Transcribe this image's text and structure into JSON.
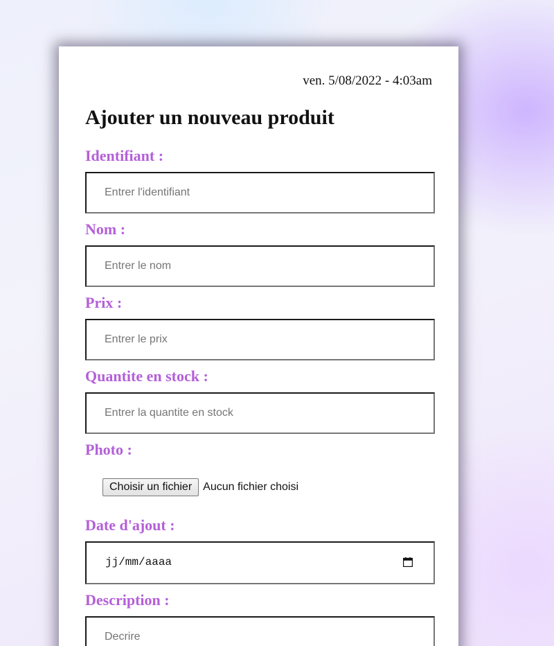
{
  "header": {
    "datetime": "ven. 5/08/2022 - 4:03am",
    "title": "Ajouter un nouveau produit"
  },
  "form": {
    "identifiant": {
      "label": "Identifiant :",
      "placeholder": "Entrer l'identifiant"
    },
    "nom": {
      "label": "Nom :",
      "placeholder": "Entrer le nom"
    },
    "prix": {
      "label": "Prix :",
      "placeholder": "Entrer le prix"
    },
    "quantite": {
      "label": "Quantite en stock :",
      "placeholder": "Entrer la quantite en stock"
    },
    "photo": {
      "label": "Photo :",
      "button_label": "Choisir un fichier",
      "status": "Aucun fichier choisi"
    },
    "date": {
      "label": "Date d'ajout :",
      "value": "jj/mm/aaaa",
      "icon": "calendar-icon"
    },
    "description": {
      "label": "Description :",
      "placeholder": "Decrire"
    }
  },
  "colors": {
    "label": "#b45fd8",
    "text": "#111111"
  }
}
